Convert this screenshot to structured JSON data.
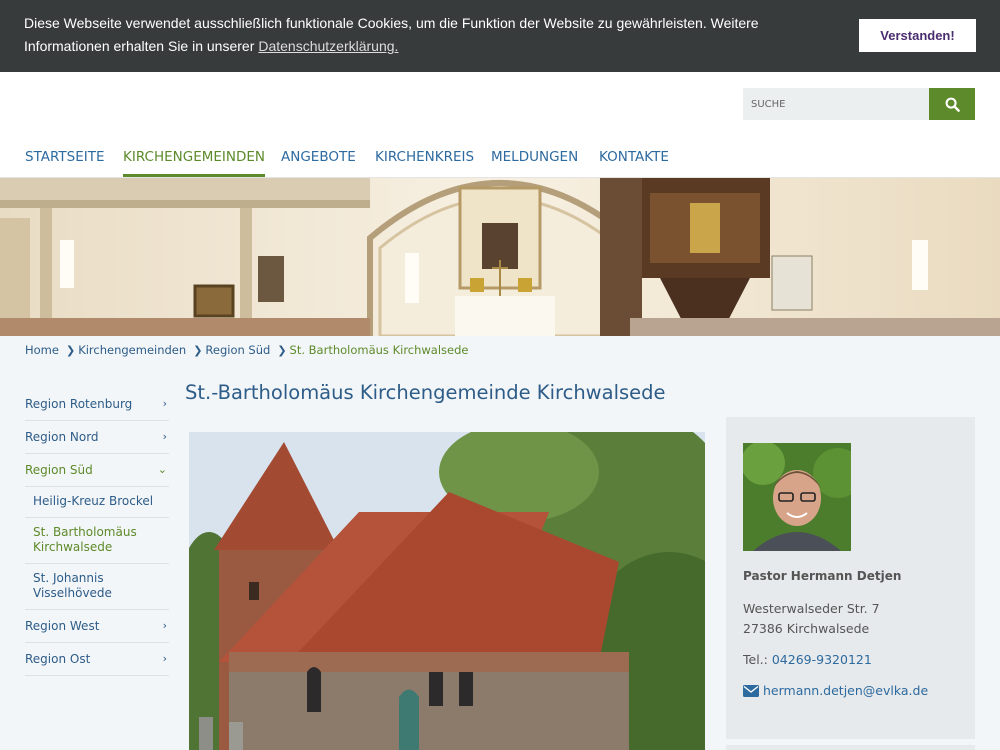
{
  "cookie_bar": {
    "message": "Diese Webseite verwendet ausschließlich funktionale Cookies, um die Funktion der Website zu gewährleisten. Weitere Informationen erhalten Sie in unserer",
    "link_label": "Datenschutzerklärung.",
    "accept_label": "Verstanden!"
  },
  "search": {
    "placeholder": "SUCHE",
    "button_icon": "search-icon"
  },
  "nav": {
    "items": [
      "STARTSEITE",
      "KIRCHENGEMEINDEN",
      "ANGEBOTE",
      "KIRCHENKREIS",
      "MELDUNGEN",
      "KONTAKTE"
    ],
    "active": "KIRCHENGEMEINDEN"
  },
  "breadcrumb": [
    "Home",
    "Kirchengemeinden",
    "Region Süd",
    "St. Bartholomäus Kirchwalsede"
  ],
  "sidebar": {
    "items": [
      {
        "label": "Region Rotenburg"
      },
      {
        "label": "Region Nord"
      },
      {
        "label": "Region Süd"
      },
      {
        "label": "Heilig-Kreuz Brockel"
      },
      {
        "label": "St. Bartholomäus Kirchwalsede"
      },
      {
        "label": "St. Johannis Visselhövede"
      },
      {
        "label": "Region West"
      },
      {
        "label": "Region Ost"
      }
    ]
  },
  "main": {
    "title": "St.-Bartholomäus Kirchengemeinde Kirchwalsede"
  },
  "contact": {
    "name": "Pastor Hermann Detjen",
    "street": "Westerwalseder Str. 7",
    "city": "27386 Kirchwalsede",
    "tel_label": "Tel.:",
    "tel": "04269-9320121",
    "email": "hermann.detjen@evlka.de"
  },
  "colors": {
    "cookie_bg": "#383b3b",
    "accent_green": "#5d8a2a",
    "link_blue": "#2d6a9f",
    "panel_gray": "#e6eaec"
  }
}
